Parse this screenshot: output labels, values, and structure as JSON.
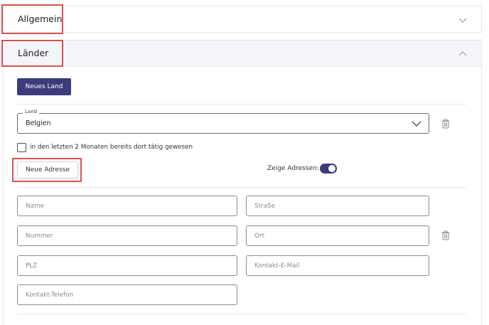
{
  "sections": {
    "general": {
      "title": "Allgemein"
    },
    "lander": {
      "title": "Länder"
    }
  },
  "lander": {
    "new_country_button": "Neues Land",
    "country_select": {
      "legend": "Land",
      "value": "Belgien"
    },
    "checkbox": {
      "label": "in den letzten 2 Monaten bereits dort tätig gewesen",
      "checked": false
    },
    "new_address_button": "Neue Adresse",
    "toggle": {
      "label": "Zeige Adressen:",
      "on": true
    }
  },
  "address_form": {
    "name": {
      "placeholder": "Name"
    },
    "strasse": {
      "placeholder": "Straße"
    },
    "nummer": {
      "placeholder": "Nummer"
    },
    "ort": {
      "placeholder": "Ort"
    },
    "plz": {
      "placeholder": "PLZ"
    },
    "email": {
      "placeholder": "Kontakt-E-Mail"
    },
    "telefon": {
      "placeholder": "Kontakt-Telefon"
    }
  },
  "colors": {
    "primary": "#3b3b7e",
    "highlight": "#d9534f",
    "border": "#e7e8ee"
  },
  "icons": {
    "chevron": "chevron-down-icon",
    "chevron_up": "chevron-up-icon",
    "trash": "trash-icon"
  }
}
